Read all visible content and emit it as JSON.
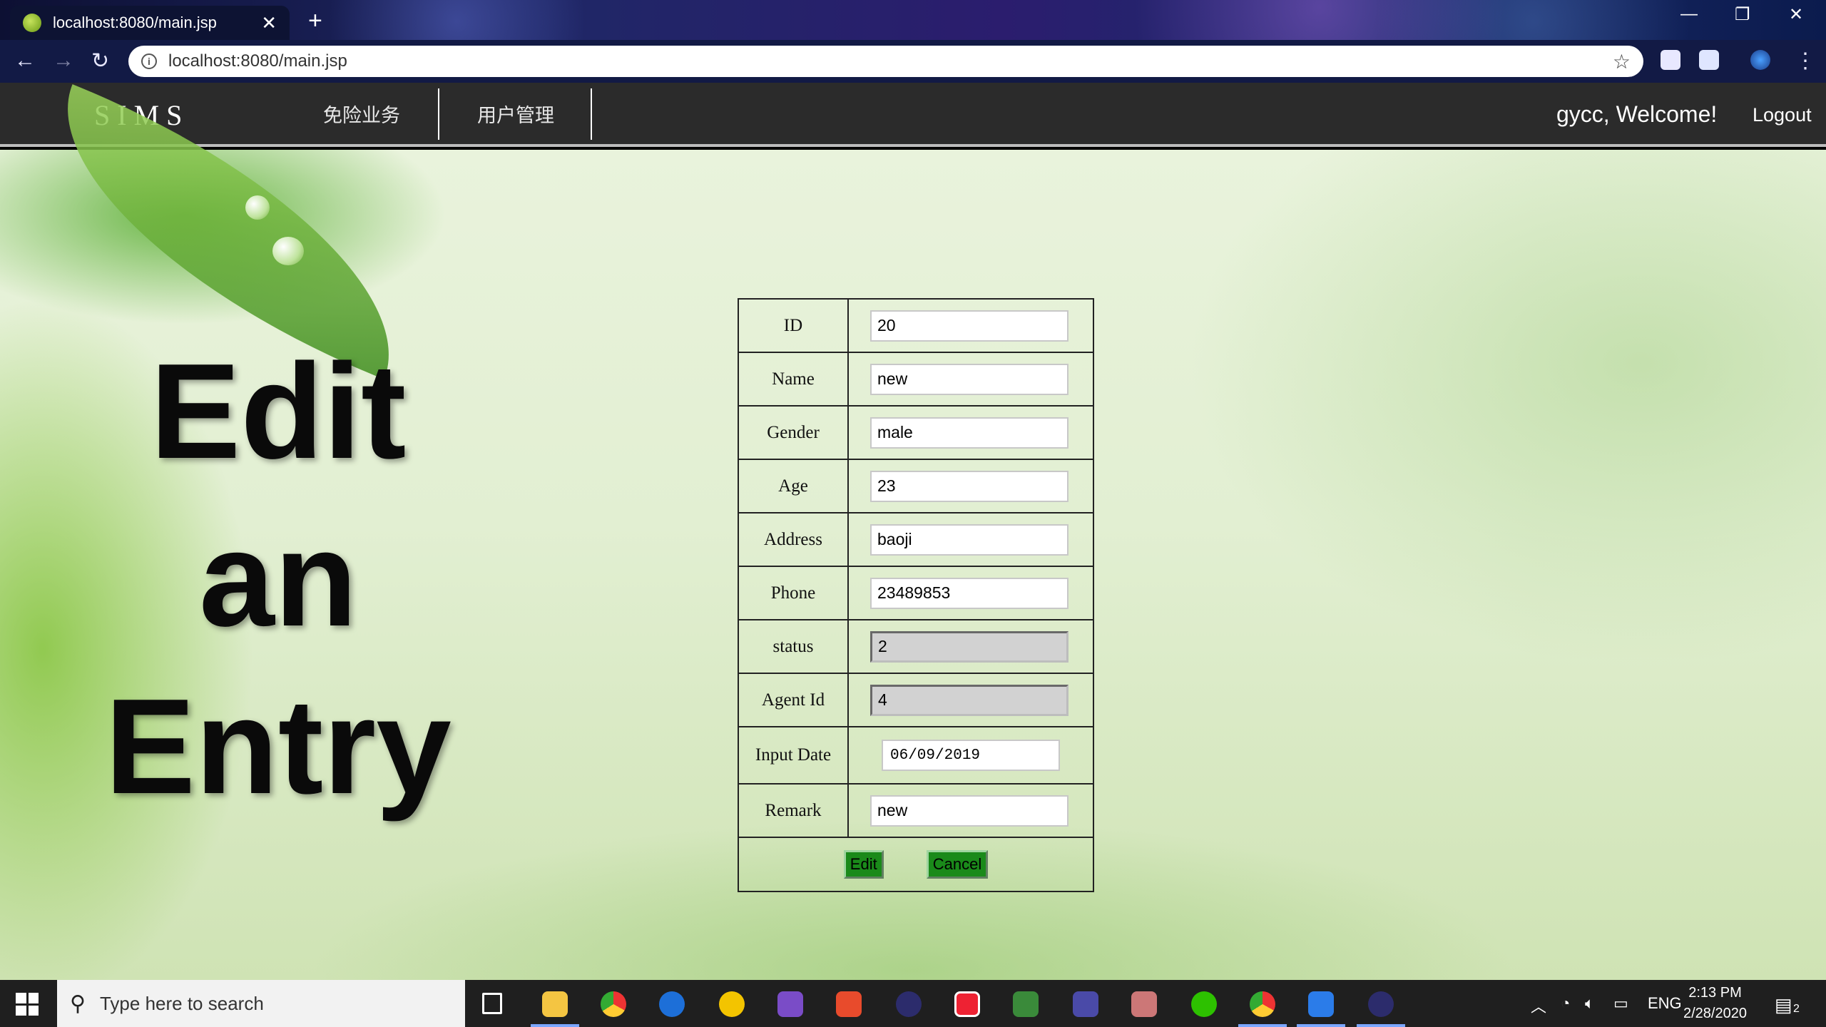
{
  "browser": {
    "tab_title": "localhost:8080/main.jsp",
    "tab_close": "✕",
    "new_tab": "+",
    "url": "localhost:8080/main.jsp",
    "window_controls": {
      "minimize": "—",
      "restore": "❐",
      "close": "✕"
    }
  },
  "nav": {
    "brand": "SIMS",
    "menu": [
      "免险业务",
      "用户管理"
    ],
    "welcome": "gycc, Welcome!",
    "logout": "Logout"
  },
  "heading": {
    "line1": "Edit",
    "line2": "an",
    "line3": "Entry"
  },
  "form": {
    "rows": [
      {
        "label": "ID",
        "value": "20"
      },
      {
        "label": "Name",
        "value": "new"
      },
      {
        "label": "Gender",
        "value": "male"
      },
      {
        "label": "Age",
        "value": "23"
      },
      {
        "label": "Address",
        "value": "baoji"
      },
      {
        "label": "Phone",
        "value": "23489853"
      },
      {
        "label": "status",
        "value": "2"
      },
      {
        "label": "Agent Id",
        "value": "4"
      },
      {
        "label": "Input Date",
        "value": "06/09/2019"
      },
      {
        "label": "Remark",
        "value": "new"
      }
    ],
    "edit_button": "Edit",
    "cancel_button": "Cancel"
  },
  "taskbar": {
    "search_placeholder": "Type here to search",
    "language": "ENG",
    "time": "2:13 PM",
    "date": "2/28/2020",
    "notification_count": "2"
  }
}
